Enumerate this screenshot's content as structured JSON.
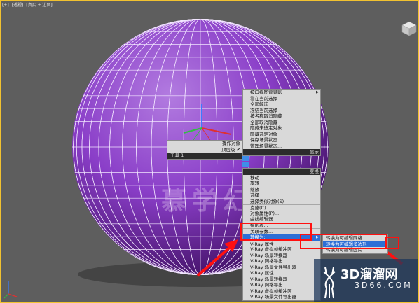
{
  "viewport": {
    "label_parts": [
      "[+]",
      "[透视]",
      "[真实 + 边面]"
    ],
    "watermark": "慕学幻真"
  },
  "quad_left": {
    "items": [
      {
        "label": "操作对象",
        "checked": false
      },
      {
        "label": "顶层级",
        "checked": true
      }
    ],
    "tools_label": "工具 1",
    "tools_right": "显示",
    "tools_right2": "变换"
  },
  "quad_top": {
    "items": [
      {
        "label": "按口视图背景影",
        "submenu": true
      },
      {
        "label": "看在当前选择"
      },
      {
        "label": "全部解冻"
      },
      {
        "label": "冻结当前选择"
      },
      {
        "label": "按名称取消隐藏"
      },
      {
        "label": "全部取消隐藏"
      },
      {
        "label": "隐藏未选定对象"
      },
      {
        "label": "隐藏选定对象"
      },
      {
        "label": "保存场景状态..."
      },
      {
        "label": "管理场景状态..."
      }
    ]
  },
  "quad_bottom": {
    "items": [
      {
        "label": "移动",
        "sep": false
      },
      {
        "label": "旋转",
        "sep": false
      },
      {
        "label": "缩放",
        "sep": false
      },
      {
        "label": "选择",
        "sep": false
      },
      {
        "label": "选择类似对象(S)",
        "sep": false
      },
      {
        "label": "克隆(C)",
        "sep": true
      },
      {
        "label": "对象属性(P)...",
        "sep": false
      },
      {
        "label": "曲线编辑器...",
        "sep": false
      },
      {
        "label": "摄影表...",
        "sep": false
      },
      {
        "label": "关联参数...",
        "sep": true
      },
      {
        "label": "转换为:",
        "sep": false,
        "highlight": true,
        "submenu": true
      },
      {
        "label": "V-Ray 属性",
        "sep": true
      },
      {
        "label": "V-Ray 虚拟帧缓冲区",
        "sep": false
      },
      {
        "label": "V-Ray 场景转换器",
        "sep": false
      },
      {
        "label": "V-Ray 网格导出",
        "sep": false
      },
      {
        "label": "V-Ray 场景文件导出器",
        "sep": false
      },
      {
        "label": "V-Ray 属性",
        "sep": false
      },
      {
        "label": "V-Ray 场景转换器",
        "sep": false
      },
      {
        "label": "V-Ray 网格导出",
        "sep": false
      },
      {
        "label": "V-Ray 虚拟帧缓冲区",
        "sep": false
      },
      {
        "label": "V-Ray 场景文件导出器",
        "sep": false
      }
    ]
  },
  "submenu": {
    "items": [
      {
        "label": "转换为可编辑网格",
        "highlight": false
      },
      {
        "label": "转换为可编辑多边形",
        "highlight": true
      },
      {
        "label": "转换为可编辑面片",
        "highlight": false
      }
    ]
  },
  "brand": {
    "title": "3D溜溜网",
    "url": "3D66.COM"
  },
  "colors": {
    "sphere": "#8a3ec8",
    "highlight": "#2d6fd6",
    "annotation": "#ff1010"
  }
}
